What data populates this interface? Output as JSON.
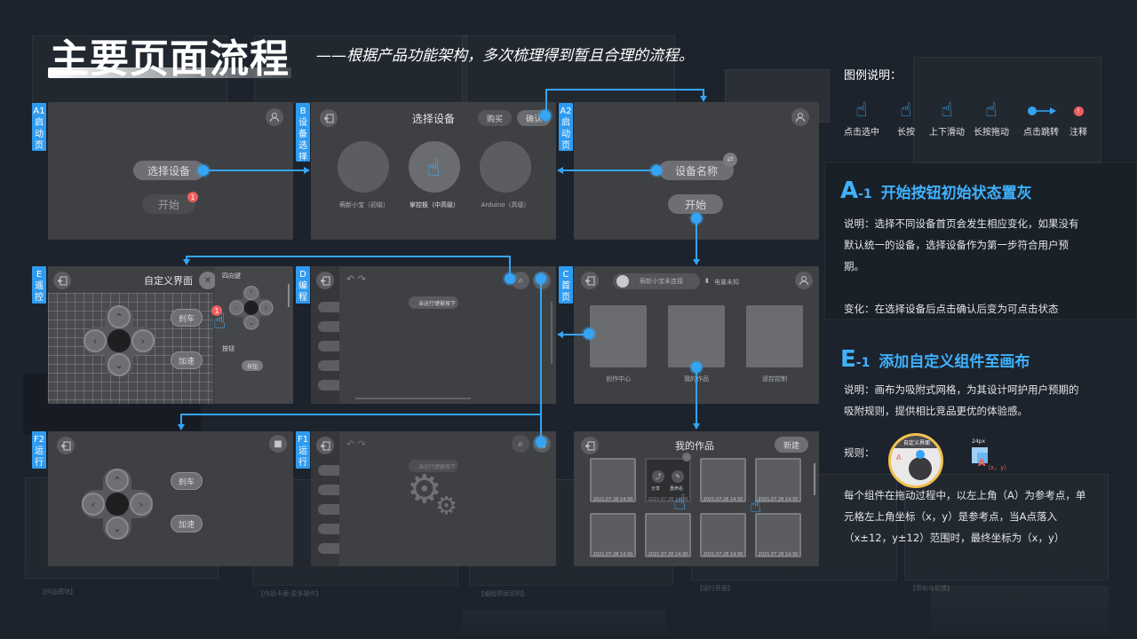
{
  "header": {
    "title": "主要页面流程",
    "subtitle": "——根据产品功能架构，多次梳理得到暂且合理的流程。"
  },
  "background_labels": {
    "b1": "【作品模块】",
    "b2": "【作品卡面-更多操作】",
    "b3": "【编程界面说明】",
    "b4": "【运行界面】",
    "b5": "【帮助与反馈】"
  },
  "screens": {
    "a1": {
      "tag": "A1 启动页",
      "select_label": "选择设备",
      "start_label": "开始",
      "badge": "1"
    },
    "b": {
      "tag": "B 设备选择",
      "title": "选择设备",
      "buy_label": "购买",
      "confirm_label": "确认",
      "devices": [
        "萌新小宝（初级）",
        "掌控板（中高级）",
        "Arduino（高级）"
      ]
    },
    "a2": {
      "tag": "A2 启动页",
      "device_name_label": "设备名称",
      "start_label": "开始"
    },
    "e": {
      "tag": "E 遥控",
      "title": "自定义界面",
      "panel_title": "四向键",
      "brake_label": "刹车",
      "speed_label": "加速",
      "button_label": "按钮",
      "button_chip": "按钮",
      "badge": "1"
    },
    "d": {
      "tag": "D 编程",
      "hint": "当运行键被按下"
    },
    "c": {
      "tag": "C 首页",
      "status": "萌新小宝未连接",
      "battery": "电量未知",
      "cards": [
        "创作中心",
        "我的作品",
        "遥控控制"
      ]
    },
    "f2": {
      "tag": "F2 运行",
      "brake_label": "刹车",
      "speed_label": "加速"
    },
    "f1": {
      "tag": "F1 运行",
      "hint": "当运行键被按下"
    },
    "works": {
      "title": "我的作品",
      "new_label": "新建",
      "share_label": "分享",
      "rename_label": "重命名",
      "dates": [
        "2021.07.28 14:30",
        "2021.07.28 14:30",
        "2021.07.28 14:30",
        "2021.07.28 14:30",
        "2021.07.28 14:30",
        "2021.07.28 14:30",
        "2021.07.28 14:30",
        "2021.07.28 14:30"
      ]
    }
  },
  "legend": {
    "heading": "图例说明：",
    "items": [
      {
        "icon": "tap-hand-icon",
        "label": "点击选中"
      },
      {
        "icon": "long-press-hand-icon",
        "label": "长按"
      },
      {
        "icon": "swipe-hand-icon",
        "label": "上下滑动"
      },
      {
        "icon": "drag-hand-icon",
        "label": "长按拖动"
      },
      {
        "icon": "jump-arrow-icon",
        "label": "点击跳转"
      },
      {
        "icon": "note-badge-icon",
        "label": "注释"
      }
    ]
  },
  "notes": {
    "a": {
      "prefix": "A",
      "suffix": "-1",
      "heading": "开始按钮初始状态置灰",
      "desc": "说明：选择不同设备首页会发生相应变化，如果没有默认统一的设备，选择设备作为第一步符合用户预期。",
      "change": "变化：在选择设备后点击确认后变为可点击状态"
    },
    "e": {
      "prefix": "E",
      "suffix": "-1",
      "heading": "添加自定义组件至画布",
      "desc": "说明：画布为吸附式网格，为其设计呵护用户预期的吸附规则，提供相比竞品更优的体验感。",
      "rule_label": "规则：",
      "rule_thumb_title": "自定义界面",
      "rule_px": "24px",
      "rule_coord": "（x，y）",
      "rule_a": "A",
      "rule_text": "每个组件在拖动过程中，以左上角（A）为参考点，单元格左上角坐标（x，y）是参考点，当A点落入（x±12，y±12）范围时，最终坐标为（x，y）"
    }
  },
  "colors": {
    "accent": "#35a4f4",
    "note_badge": "#ef5d5d",
    "background": "#1d232c",
    "screen": "#3f4043"
  }
}
